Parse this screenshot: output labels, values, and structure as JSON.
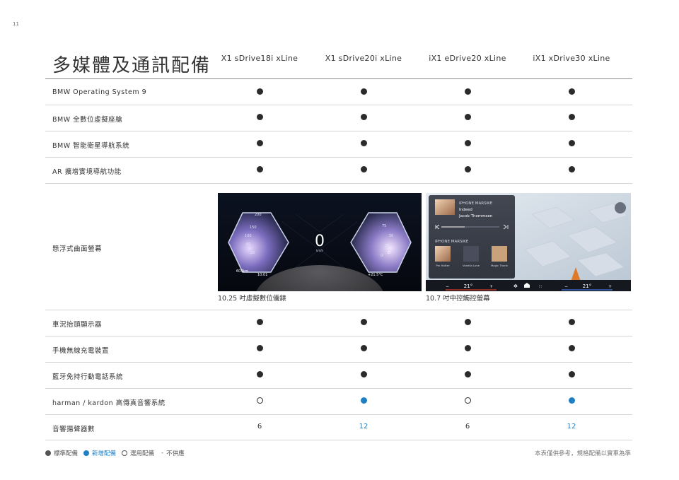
{
  "page_number": "11",
  "title": "多媒體及通訊配備",
  "columns": [
    "X1 sDrive18i xLine",
    "X1 sDrive20i xLine",
    "iX1 eDrive20 xLine",
    "iX1 xDrive30 xLine"
  ],
  "rows": [
    {
      "label": "BMW Operating System 9",
      "cells": [
        "standard",
        "standard",
        "standard",
        "standard"
      ]
    },
    {
      "label": "BMW 全數位虛擬座艙",
      "cells": [
        "standard",
        "standard",
        "standard",
        "standard"
      ]
    },
    {
      "label": "BMW 智能衛星導航系統",
      "cells": [
        "standard",
        "standard",
        "standard",
        "standard"
      ]
    },
    {
      "label": "AR 擴增實境導航功能",
      "cells": [
        "standard",
        "standard",
        "standard",
        "standard"
      ]
    }
  ],
  "screen_row": {
    "label": "懸浮式曲面螢幕",
    "cluster_caption": "10.25 吋虛擬數位儀錶",
    "display_caption": "10.7 吋中控觸控螢幕",
    "cluster": {
      "speed": "0",
      "speed_unit": "km/h",
      "range": "603km",
      "time": "10:01",
      "temp": "+21.5°C",
      "gear": "D",
      "left_gauge_ticks": [
        "200",
        "150",
        "100",
        "60",
        "20"
      ],
      "right_gauge_ticks": [
        "75",
        "50",
        "25",
        "0"
      ]
    },
    "infotainment": {
      "now_playing_source": "IPHONE MARSIKE",
      "track_title": "Indeed",
      "track_artist": "Jacob Thommsen",
      "list_source": "IPHONE MARSIKE",
      "tiles": [
        "Pro Hotter",
        "Vonella Love",
        "Magic Thank"
      ],
      "temp_left": "21°",
      "temp_right": "21°",
      "minus": "−",
      "plus": "+"
    }
  },
  "rows_after": [
    {
      "label": "車況抬頭顯示器",
      "cells": [
        "standard",
        "standard",
        "standard",
        "standard"
      ]
    },
    {
      "label": "手機無線充電裝置",
      "cells": [
        "standard",
        "standard",
        "standard",
        "standard"
      ]
    },
    {
      "label": "藍牙免持行動電話系統",
      "cells": [
        "standard",
        "standard",
        "standard",
        "standard"
      ]
    },
    {
      "label": "harman / kardon 高傳真音響系統",
      "cells": [
        "optional",
        "new",
        "optional",
        "new"
      ]
    },
    {
      "label": "音響揚聲器數",
      "cells": [
        "6",
        "12",
        "6",
        "12"
      ],
      "highlight": [
        false,
        true,
        false,
        true
      ]
    }
  ],
  "legend": {
    "standard": "標準配備",
    "new": "新增配備",
    "optional": "選用配備",
    "dash": "-",
    "not_available": "不供應"
  },
  "disclaimer": "本表僅供參考，規格配備以實車為準",
  "colors": {
    "accent_blue": "#1f7fc4",
    "dot_dark": "#2b2b2b",
    "rule": "#8a8a8a"
  }
}
